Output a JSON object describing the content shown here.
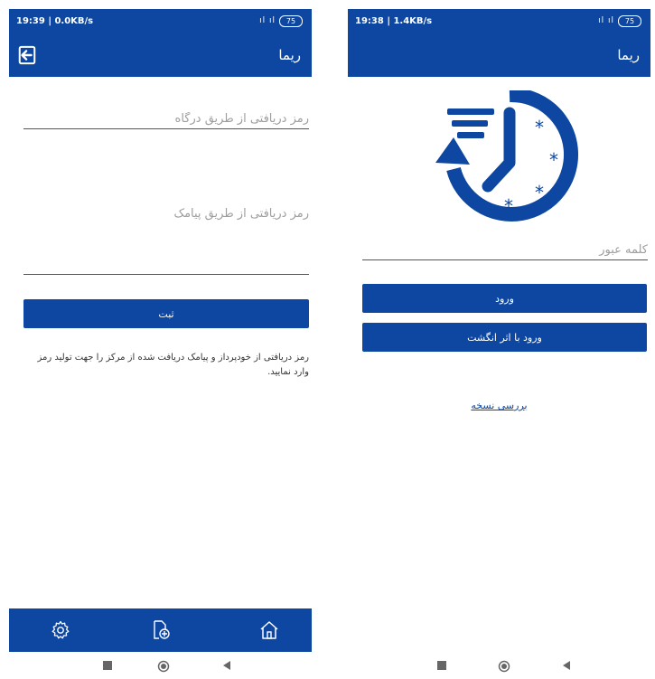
{
  "left": {
    "status": {
      "time": "19:39 | 0.0KB/s",
      "battery": "75",
      "signal": "ıl ıl"
    },
    "appbar": {
      "title": "ریما",
      "exit_icon": "exit-icon"
    },
    "gateway_field": {
      "placeholder": "رمز دریافتی از طریق درگاه"
    },
    "sms_field": {
      "placeholder": "رمز دریافتی از طریق پیامک"
    },
    "submit_label": "ثبت",
    "note": "رمز دریافتی از خودپرداز و پیامک دریافت شده از مرکز را جهت تولید رمز وارد نمایید.",
    "bottom_icons": [
      "gear-icon",
      "add-document-icon",
      "home-icon"
    ]
  },
  "right": {
    "status": {
      "time": "19:38 | 1.4KB/s",
      "battery": "75",
      "signal": "ıl ıl"
    },
    "appbar": {
      "title": "ریما"
    },
    "logo_icon": "fast-clock-icon",
    "password_field": {
      "placeholder": "کلمه عبور"
    },
    "login_label": "ورود",
    "fingerprint_login_label": "ورود با اثر انگشت",
    "check_version_label": "بررسی نسخه"
  },
  "colors": {
    "primary": "#0d47a1",
    "background": "#ffffff"
  }
}
